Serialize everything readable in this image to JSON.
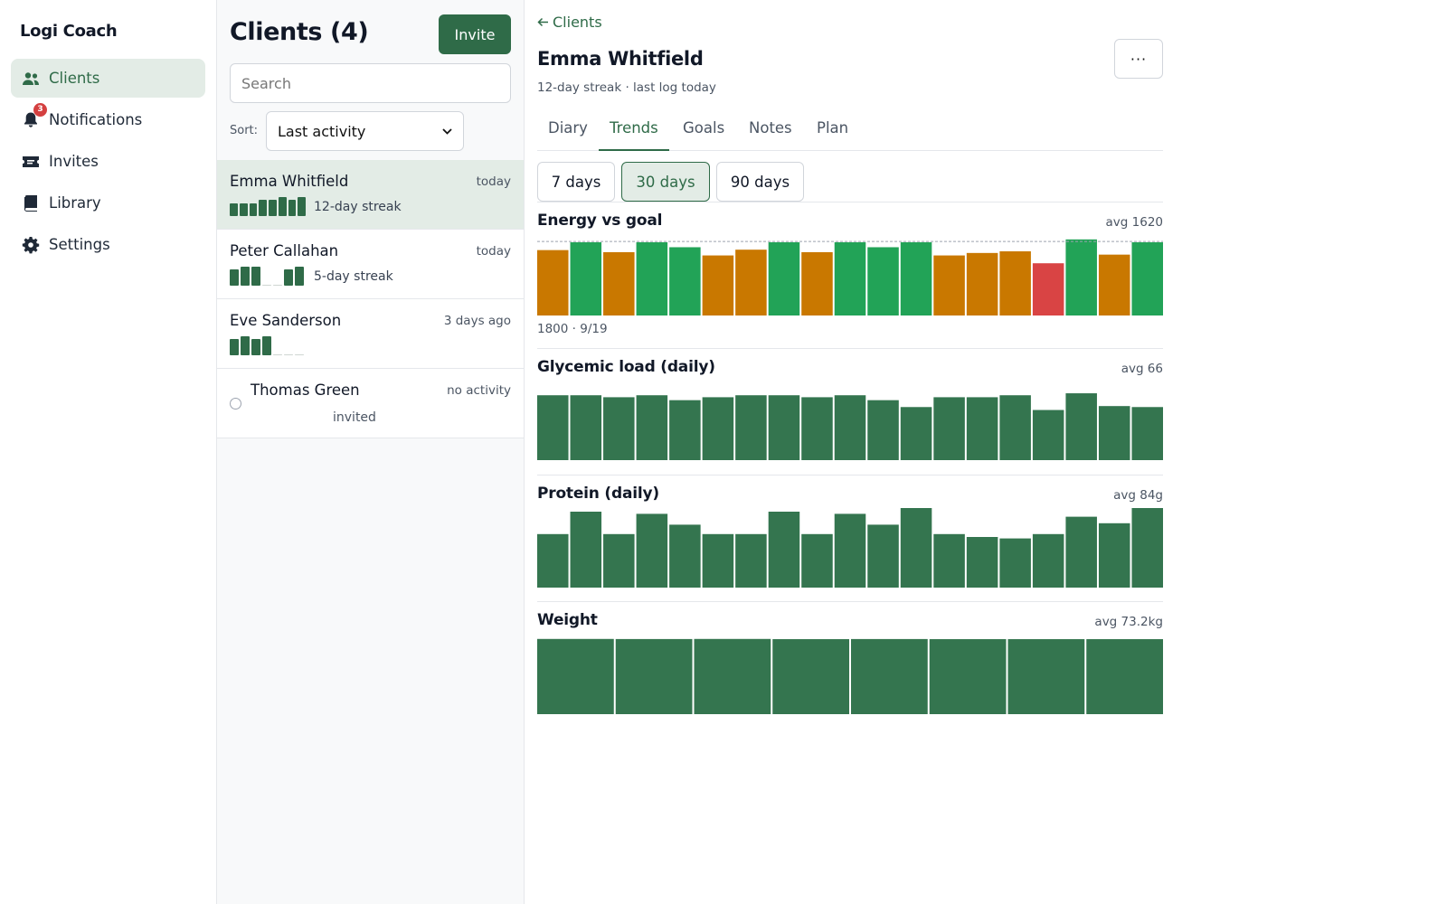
{
  "app": {
    "title": "Logi Coach"
  },
  "sidebar": {
    "items": [
      {
        "label": "Clients",
        "icon": "users-icon",
        "active": true
      },
      {
        "label": "Notifications",
        "icon": "bell-icon",
        "badge": "3"
      },
      {
        "label": "Invites",
        "icon": "ticket-icon"
      },
      {
        "label": "Library",
        "icon": "book-icon"
      },
      {
        "label": "Settings",
        "icon": "gear-icon"
      }
    ]
  },
  "list": {
    "title": "Clients (4)",
    "invite_label": "Invite",
    "search_placeholder": "Search",
    "sort_label": "Sort:",
    "sort_value": "Last activity",
    "clients": [
      {
        "name": "Emma Whitfield",
        "time": "today",
        "streak": "12-day streak",
        "spark": [
          0.65,
          0.65,
          0.65,
          0.8,
          0.8,
          0.95,
          0.8,
          0.95
        ]
      },
      {
        "name": "Peter Callahan",
        "time": "today",
        "streak": "5-day streak",
        "spark": [
          0.8,
          0.95,
          0.95,
          0,
          0,
          0.8,
          0.95
        ]
      },
      {
        "name": "Eve Sanderson",
        "time": "3 days ago",
        "streak": "",
        "spark": [
          0.8,
          0.95,
          0.8,
          0.95,
          0,
          0,
          0
        ]
      },
      {
        "name": "Thomas Green",
        "time": "no activity",
        "status": "invited"
      }
    ]
  },
  "detail": {
    "back_label": "Clients",
    "name": "Emma Whitfield",
    "subtitle": "12-day streak · last log today",
    "more_label": "···",
    "tabs": [
      "Diary",
      "Trends",
      "Goals",
      "Notes",
      "Plan"
    ],
    "active_tab": "Trends",
    "ranges": [
      "7 days",
      "30 days",
      "90 days"
    ],
    "active_range": "30 days"
  },
  "colors": {
    "accent": "#2f6b48",
    "good": "#22a357",
    "warn": "#c97800",
    "bad": "#d94444",
    "bar": "#34754f"
  },
  "chart_data": [
    {
      "type": "bar",
      "title": "Energy vs goal",
      "avg_label": "avg 1620",
      "caption": "1800 · 9/19",
      "goal": 1800,
      "ylim": [
        0,
        2000
      ],
      "values": [
        1590,
        1780,
        1540,
        1780,
        1660,
        1460,
        1600,
        1780,
        1540,
        1780,
        1660,
        1780,
        1460,
        1520,
        1560,
        1270,
        1850,
        1480,
        1780
      ],
      "status": [
        "warn",
        "good",
        "warn",
        "good",
        "good",
        "warn",
        "warn",
        "good",
        "warn",
        "good",
        "good",
        "good",
        "warn",
        "warn",
        "warn",
        "bad",
        "good",
        "warn",
        "good"
      ]
    },
    {
      "type": "bar",
      "title": "Glycemic load (daily)",
      "avg_label": "avg 66",
      "ylim": [
        0,
        80
      ],
      "values": [
        66,
        66,
        64,
        66,
        61,
        64,
        66,
        66,
        64,
        66,
        61,
        54,
        64,
        64,
        66,
        51,
        68,
        55,
        54
      ]
    },
    {
      "type": "bar",
      "title": "Protein (daily)",
      "avg_label": "avg 84g",
      "ylim": [
        0,
        110
      ],
      "values": [
        74,
        105,
        74,
        102,
        87,
        74,
        74,
        105,
        74,
        102,
        87,
        110,
        74,
        70,
        68,
        74,
        98,
        89,
        110
      ]
    },
    {
      "type": "bar",
      "title": "Weight",
      "avg_label": "avg 73.2kg",
      "ylim": [
        0,
        74
      ],
      "values": [
        73.3,
        73.2,
        73.3,
        73.1,
        73.2,
        73.1,
        73.1,
        73.1
      ]
    }
  ]
}
